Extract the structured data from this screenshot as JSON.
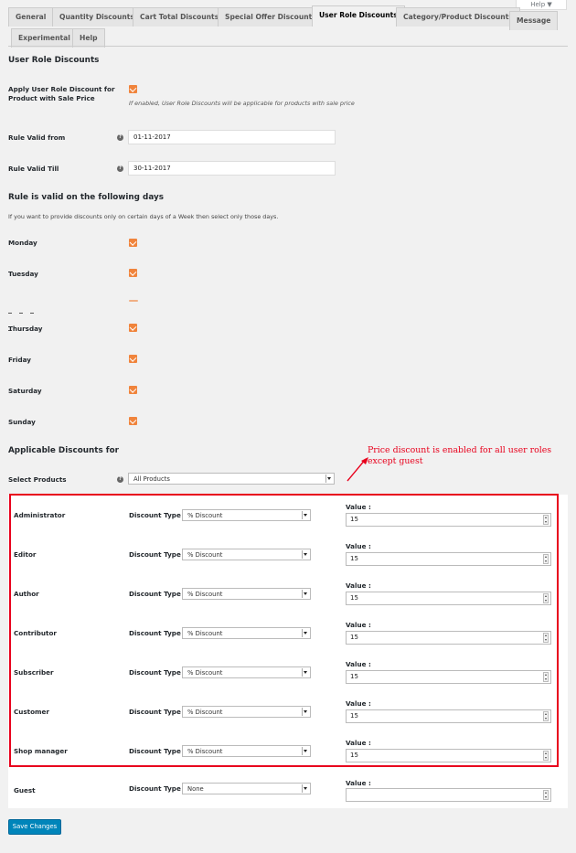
{
  "help_tab": "Help ▼",
  "tabs": [
    {
      "label": "General"
    },
    {
      "label": "Quantity Discounts"
    },
    {
      "label": "Cart Total Discounts"
    },
    {
      "label": "Special Offer Discounts"
    },
    {
      "label": "User Role Discounts",
      "active": true
    },
    {
      "label": "Category/Product Discounts"
    },
    {
      "label": "Message"
    },
    {
      "label": "Experimental"
    },
    {
      "label": "Help"
    }
  ],
  "section_title": "User Role Discounts",
  "sale_price": {
    "label": "Apply User Role Discount for Product with Sale Price",
    "checked": true,
    "description": "If enabled, User Role Discounts will be applicable for products with sale price"
  },
  "valid_from": {
    "label": "Rule Valid from",
    "value": "01-11-2017"
  },
  "valid_till": {
    "label": "Rule Valid Till",
    "value": "30-11-2017"
  },
  "days_heading": "Rule is valid on the following days",
  "days_note": "If you want to provide discounts only on certain days of a Week then select only those days.",
  "days": [
    {
      "label": "Monday",
      "checked": true
    },
    {
      "label": "Tuesday",
      "checked": true
    },
    {
      "label": "Thursday",
      "checked": true
    },
    {
      "label": "Friday",
      "checked": true
    },
    {
      "label": "Saturday",
      "checked": true
    },
    {
      "label": "Sunday",
      "checked": true
    }
  ],
  "applicable_heading": "Applicable Discounts for",
  "select_products": {
    "label": "Select Products",
    "value": "All Products"
  },
  "annotation": "Price discount is enabled for all user roles except guest",
  "discount_type_label": "Discount Type :",
  "value_label": "Value :",
  "roles": [
    {
      "role": "Administrator",
      "type": "% Discount",
      "value": "15"
    },
    {
      "role": "Editor",
      "type": "% Discount",
      "value": "15"
    },
    {
      "role": "Author",
      "type": "% Discount",
      "value": "15"
    },
    {
      "role": "Contributor",
      "type": "% Discount",
      "value": "15"
    },
    {
      "role": "Subscriber",
      "type": "% Discount",
      "value": "15"
    },
    {
      "role": "Customer",
      "type": "% Discount",
      "value": "15"
    },
    {
      "role": "Shop manager",
      "type": "% Discount",
      "value": "15"
    },
    {
      "role": "Guest",
      "type": "None",
      "value": ""
    }
  ],
  "save_button": "Save Changes",
  "colors": {
    "checkbox": "#f0843c",
    "annotation": "#e8001c",
    "primary": "#0085ba"
  }
}
